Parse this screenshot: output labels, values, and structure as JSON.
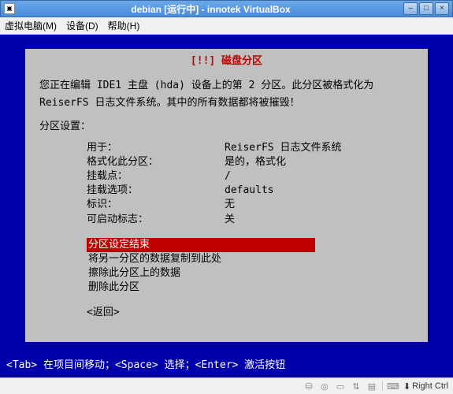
{
  "window": {
    "title": "debian [运行中] - innotek VirtualBox",
    "min": "–",
    "max": "□",
    "close": "×"
  },
  "menu": {
    "machine": "虚拟电脑(M)",
    "devices": "设备(D)",
    "help": "帮助(H)"
  },
  "installer": {
    "title_prefix": "────┤ ",
    "title": "[!!] 磁盘分区",
    "title_suffix": " ├────",
    "desc1": "您正在编辑 IDE1 主盘 (hda) 设备上的第 2 分区。此分区被格式化为",
    "desc2": "ReiserFS 日志文件系统。其中的所有数据都将被摧毁！",
    "section": "分区设置：",
    "settings": [
      {
        "key": "用于：",
        "val": "ReiserFS 日志文件系统"
      },
      {
        "key": "格式化此分区：",
        "val": "是的，格式化"
      },
      {
        "key": "挂载点：",
        "val": "/"
      },
      {
        "key": "挂载选项：",
        "val": "defaults"
      },
      {
        "key": "标识：",
        "val": "无"
      },
      {
        "key": "可启动标志：",
        "val": "关"
      }
    ],
    "actions": [
      "分区设定结束",
      "将另一分区的数据复制到此处",
      "擦除此分区上的数据",
      "删除此分区"
    ],
    "selected_index": 0,
    "return": "<返回>"
  },
  "footer": "<Tab> 在项目间移动；<Space> 选择；<Enter> 激活按钮",
  "status": {
    "capture": "Right Ctrl"
  }
}
